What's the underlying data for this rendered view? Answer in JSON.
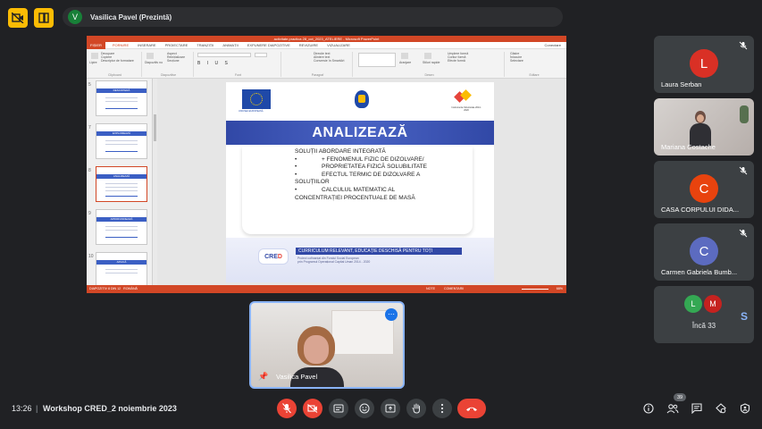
{
  "topbar": {
    "presenter_initial": "V",
    "presenter_name": "Vasilica Pavel (Prezintă)",
    "icons": [
      "camera-off-icon",
      "window-icon"
    ]
  },
  "powerpoint": {
    "window_title": "activitate.practica 28_oct_2023_ATELIERE - Microsoft PowerPoint",
    "tabs": [
      "FIȘIER",
      "PORNIRE",
      "INSERARE",
      "PROIECTARE",
      "TRANZIȚII",
      "ANIMAȚII",
      "EXPUNERE DIAPOZITIVE",
      "REVIZUIRE",
      "VIZUALIZARE"
    ],
    "active_tab": "PORNIRE",
    "conectare": "Conectare",
    "ribbon": {
      "clipboard": [
        "Decupare",
        "Copiere",
        "Descriptor de formatare"
      ],
      "clipboard_label": "Clipboard",
      "paste_label": "Lipire",
      "slides": [
        "Aspect",
        "Reinițializare",
        "Secțiune"
      ],
      "new_slide": "Diapozitiv nou",
      "slides_label": "Diapozitive",
      "font_label": "Font",
      "paragraph": [
        "Direcție text",
        "Aliniere text",
        "Conversie în SmartArt"
      ],
      "paragraph_label": "Paragraf",
      "arrange": "Aranjare",
      "quick_styles": "Stiluri rapide",
      "shape_opts": [
        "Umplere formă",
        "Contur formă",
        "Efecte formă"
      ],
      "drawing_label": "Desen",
      "editing": [
        "Găsire",
        "Înlocuire",
        "Selectare"
      ],
      "editing_label": "Editare"
    },
    "thumbnails": [
      {
        "num": "5",
        "title": "DESCOPERĂ"
      },
      {
        "num": "7",
        "title": "EXPLOREAZĂ"
      },
      {
        "num": "8",
        "title": "ANALIZEAZĂ"
      },
      {
        "num": "9",
        "title": "APROFUNDEAZĂ"
      },
      {
        "num": "10",
        "title": "APLICĂ"
      }
    ],
    "selected_thumbnail": "8",
    "status_left": "DIAPOZITIV 8 DIN 12",
    "status_lang": "ROMÂNĂ",
    "status_notes": "NOTE",
    "status_comments": "COMENTARII",
    "zoom": "68%"
  },
  "slide": {
    "title": "ANALIZEAZĂ",
    "eu_caption": "UNIUNEA EUROPEANĂ",
    "poc_caption": "Instrumente Structurale 2014-2020",
    "content_lines": [
      {
        "bullet": "",
        "text": "SOLUȚII ABORDARE INTEGRATĂ"
      },
      {
        "bullet": "•",
        "text": "+ FENOMENUL FIZIC DE DIZOLVARE/"
      },
      {
        "bullet": "•",
        "text": "PROPRIETATEA FIZICĂ SOLUBILITATE"
      },
      {
        "bullet": "•",
        "text": "EFECTUL TERMIC DE DIZOLVARE A"
      },
      {
        "bullet": "",
        "text": "SOLUȚIILOR"
      },
      {
        "bullet": "•",
        "text": "CALCULUL MATEMATIC AL"
      },
      {
        "bullet": "",
        "text": "CONCENTRAȚIEI PROCENTUALE DE MASĂ"
      }
    ],
    "cred_logo_a": "CRE",
    "cred_logo_b": "D",
    "curriculum": "CURRICULUM RELEVANT, EDUCAȚIE DESCHISĂ PENTRU TOȚI",
    "cofinantat": [
      "Proiect cofinanțat din Fondul Social European",
      "prin Programul Operațional Capital Uman 2014 - 2020"
    ]
  },
  "participants": [
    {
      "name": "Laura Serban",
      "initial": "L",
      "color": "#d93025",
      "type": "avatar"
    },
    {
      "name": "Mariana Costache",
      "initial": "",
      "color": "",
      "type": "video"
    },
    {
      "name": "CASA CORPULUI DIDA...",
      "initial": "C",
      "color": "#e8430e",
      "type": "avatar"
    },
    {
      "name": "Carmen Gabriela Bumb...",
      "initial": "C",
      "color": "#5c6bc0",
      "type": "avatar"
    }
  ],
  "more_participants": {
    "count_label": "Încă 33",
    "initials": [
      "L",
      "M"
    ],
    "colors": [
      "#34a853",
      "#c5221f"
    ]
  },
  "self_view": {
    "name": "Vasilica Pavel"
  },
  "bottom": {
    "time": "13:26",
    "separator": "|",
    "meeting_title": "Workshop CRED_2 noiembrie 2023",
    "people_count": "39",
    "controls": [
      "mic-off-icon",
      "camera-off-icon",
      "captions-icon",
      "emoji-icon",
      "present-icon",
      "raise-hand-icon",
      "more-options-icon",
      "end-call-icon"
    ],
    "right_icons": [
      "info-icon",
      "people-icon",
      "chat-icon",
      "activities-icon",
      "host-controls-icon"
    ]
  }
}
